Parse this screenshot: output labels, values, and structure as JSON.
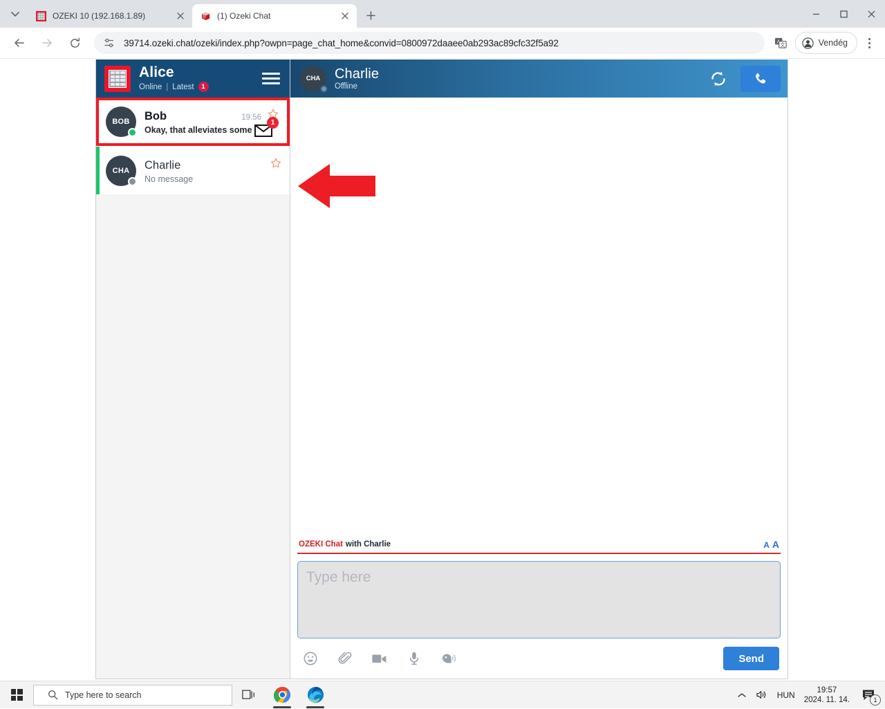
{
  "browser": {
    "tabs": [
      {
        "title": "OZEKI 10 (192.168.1.89)",
        "favicon": "ozeki-grid-icon",
        "active": false
      },
      {
        "title": "(1) Ozeki Chat",
        "favicon": "ozeki-cube-icon",
        "active": true
      }
    ],
    "new_tab_label": "+",
    "address": "39714.ozeki.chat/ozeki/index.php?owpn=page_chat_home&convid=0800972daaee0ab293ac89cfc32f5a92",
    "profile_label": "Vendég",
    "icons": {
      "back": "back-arrow-icon",
      "forward": "forward-arrow-icon",
      "reload": "reload-icon",
      "site_info": "site-settings-icon",
      "translate": "translate-icon",
      "menu": "three-dot-menu-icon"
    }
  },
  "app": {
    "sidebar": {
      "user": {
        "name": "Alice",
        "status": "Online",
        "divider": "|",
        "latest_label": "Latest",
        "latest_count": "1",
        "logo": "ozeki-keypad-logo"
      },
      "menu_icon": "hamburger-menu-icon",
      "conversations": [
        {
          "avatar": "BOB",
          "name": "Bob",
          "time": "19:56",
          "preview": "Okay, that alleviates some concerns",
          "presence": "online",
          "unread_count": "1",
          "starred": false,
          "highlighted": true,
          "active": false
        },
        {
          "avatar": "CHA",
          "name": "Charlie",
          "time": "",
          "preview": "No message",
          "presence": "offline",
          "unread_count": "",
          "starred": false,
          "highlighted": false,
          "active": true
        }
      ]
    },
    "chat": {
      "avatar": "CHA",
      "name": "Charlie",
      "status": "Offline",
      "presence": "offline",
      "refresh_icon": "refresh-icon",
      "call_icon": "phone-call-icon",
      "composer": {
        "brand": "OZEKI Chat",
        "with": "with Charlie",
        "font_small": "A",
        "font_large": "A",
        "placeholder": "Type here",
        "value": "",
        "tools": [
          {
            "icon": "emoji-icon",
            "label": "Emoji"
          },
          {
            "icon": "paperclip-attachment-icon",
            "label": "Attach file"
          },
          {
            "icon": "video-camera-icon",
            "label": "Video"
          },
          {
            "icon": "microphone-icon",
            "label": "Voice message"
          },
          {
            "icon": "text-to-speech-icon",
            "label": "Speech"
          }
        ],
        "send_label": "Send"
      }
    },
    "annotation": {
      "arrow": "red-left-arrow-annotation",
      "color": "#ee1c25"
    }
  },
  "taskbar": {
    "start_icon": "windows-start-icon",
    "search_placeholder": "Type here to search",
    "search_icon": "search-icon",
    "taskview_icon": "task-view-icon",
    "apps": [
      {
        "icon": "google-chrome-icon",
        "running": true
      },
      {
        "icon": "microsoft-edge-icon",
        "running": true
      }
    ],
    "tray": {
      "overflow_icon": "chevron-up-icon",
      "volume_icon": "speaker-icon",
      "language": "HUN",
      "time": "19:57",
      "date": "2024. 11. 14.",
      "notification_icon": "notification-icon",
      "notification_count": "1"
    }
  },
  "colors": {
    "sidebar_header": "#164b77",
    "chat_header_start": "#18486f",
    "chat_header_end": "#3f95ce",
    "accent_red": "#ee1c25",
    "brand_red": "#d91f22",
    "online_green": "#1fc46a",
    "button_blue": "#2f80d8"
  }
}
